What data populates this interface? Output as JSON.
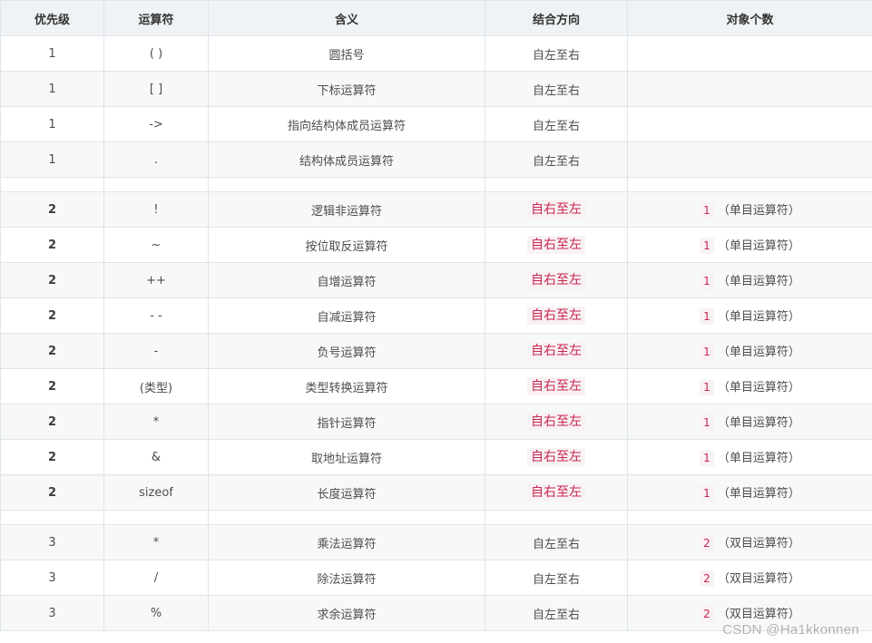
{
  "table": {
    "headers": [
      "优先级",
      "运算符",
      "含义",
      "结合方向",
      "对象个数"
    ],
    "rows": [
      {
        "type": "data",
        "priority": "1",
        "operator": "( )",
        "meaning": "圆括号",
        "direction": "自左至右",
        "dir_highlight": false,
        "count_num": "",
        "count_text": ""
      },
      {
        "type": "data",
        "priority": "1",
        "operator": "[ ]",
        "meaning": "下标运算符",
        "direction": "自左至右",
        "dir_highlight": false,
        "count_num": "",
        "count_text": ""
      },
      {
        "type": "data",
        "priority": "1",
        "operator": "->",
        "meaning": "指向结构体成员运算符",
        "direction": "自左至右",
        "dir_highlight": false,
        "count_num": "",
        "count_text": ""
      },
      {
        "type": "data",
        "priority": "1",
        "operator": ".",
        "meaning": "结构体成员运算符",
        "direction": "自左至右",
        "dir_highlight": false,
        "count_num": "",
        "count_text": ""
      },
      {
        "type": "spacer"
      },
      {
        "type": "data",
        "bold": true,
        "priority": "2",
        "operator": "!",
        "meaning": "逻辑非运算符",
        "direction": "自右至左",
        "dir_highlight": true,
        "count_num": "1",
        "count_text": "（单目运算符）"
      },
      {
        "type": "data",
        "bold": true,
        "priority": "2",
        "operator": "~",
        "meaning": "按位取反运算符",
        "direction": "自右至左",
        "dir_highlight": true,
        "count_num": "1",
        "count_text": "（单目运算符）"
      },
      {
        "type": "data",
        "bold": true,
        "priority": "2",
        "operator": "++",
        "meaning": "自增运算符",
        "direction": "自右至左",
        "dir_highlight": true,
        "count_num": "1",
        "count_text": "（单目运算符）"
      },
      {
        "type": "data",
        "bold": true,
        "priority": "2",
        "operator": "- -",
        "meaning": "自减运算符",
        "direction": "自右至左",
        "dir_highlight": true,
        "count_num": "1",
        "count_text": "（单目运算符）"
      },
      {
        "type": "data",
        "bold": true,
        "priority": "2",
        "operator": "-",
        "meaning": "负号运算符",
        "direction": "自右至左",
        "dir_highlight": true,
        "count_num": "1",
        "count_text": "（单目运算符）"
      },
      {
        "type": "data",
        "bold": true,
        "priority": "2",
        "operator": "(类型)",
        "meaning": "类型转换运算符",
        "direction": "自右至左",
        "dir_highlight": true,
        "count_num": "1",
        "count_text": "（单目运算符）"
      },
      {
        "type": "data",
        "bold": true,
        "priority": "2",
        "operator": "*",
        "meaning": "指针运算符",
        "direction": "自右至左",
        "dir_highlight": true,
        "count_num": "1",
        "count_text": "（单目运算符）"
      },
      {
        "type": "data",
        "bold": true,
        "priority": "2",
        "operator": "&",
        "meaning": "取地址运算符",
        "direction": "自右至左",
        "dir_highlight": true,
        "count_num": "1",
        "count_text": "（单目运算符）"
      },
      {
        "type": "data",
        "bold": true,
        "priority": "2",
        "operator": "sizeof",
        "meaning": "长度运算符",
        "direction": "自右至左",
        "dir_highlight": true,
        "count_num": "1",
        "count_text": "（单目运算符）"
      },
      {
        "type": "spacer"
      },
      {
        "type": "data",
        "priority": "3",
        "operator": "*",
        "meaning": "乘法运算符",
        "direction": "自左至右",
        "dir_highlight": false,
        "count_num": "2",
        "count_text": "（双目运算符）"
      },
      {
        "type": "data",
        "priority": "3",
        "operator": "/",
        "meaning": "除法运算符",
        "direction": "自左至右",
        "dir_highlight": false,
        "count_num": "2",
        "count_text": "（双目运算符）"
      },
      {
        "type": "data",
        "priority": "3",
        "operator": "%",
        "meaning": "求余运算符",
        "direction": "自左至右",
        "dir_highlight": false,
        "count_num": "2",
        "count_text": "（双目运算符）"
      }
    ]
  },
  "watermark": "CSDN @Ha1kkonnen",
  "colors": {
    "header_bg": "#eff3f5",
    "stripe_bg": "#f7f8f8",
    "code_red": "#c7254e",
    "code_bg": "#f9f2f4",
    "border": "#e1e4e8"
  }
}
